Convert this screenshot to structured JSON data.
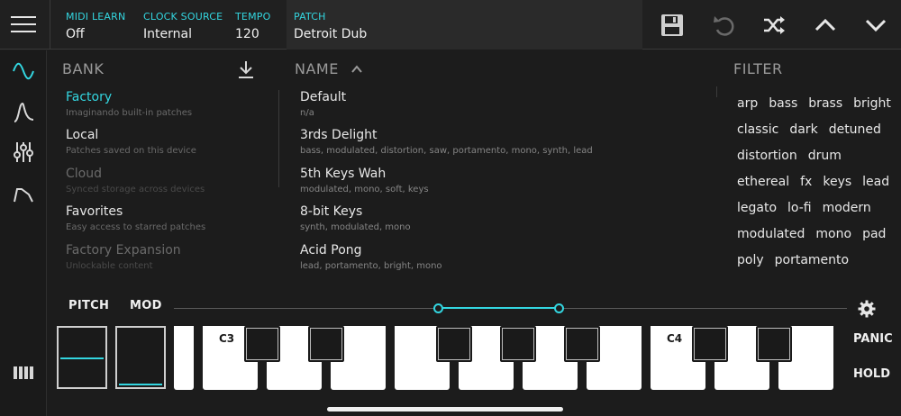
{
  "topbar": {
    "midi_learn": {
      "label": "MIDI LEARN",
      "value": "Off"
    },
    "clock_source": {
      "label": "CLOCK SOURCE",
      "value": "Internal"
    },
    "tempo": {
      "label": "TEMPO",
      "value": "120"
    },
    "patch": {
      "label": "PATCH",
      "value": "Detroit Dub"
    }
  },
  "bank": {
    "header": "BANK",
    "items": [
      {
        "title": "Factory",
        "subtitle": "Imaginando built-in patches"
      },
      {
        "title": "Local",
        "subtitle": "Patches saved on this device"
      },
      {
        "title": "Cloud",
        "subtitle": "Synced storage across devices"
      },
      {
        "title": "Favorites",
        "subtitle": "Easy access to starred patches"
      },
      {
        "title": "Factory Expansion",
        "subtitle": "Unlockable content"
      }
    ]
  },
  "name": {
    "header": "NAME",
    "items": [
      {
        "title": "Default",
        "subtitle": "n/a"
      },
      {
        "title": "3rds Delight",
        "subtitle": "bass, modulated, distortion, saw, portamento, mono, synth, lead"
      },
      {
        "title": "5th Keys Wah",
        "subtitle": "modulated, mono, soft, keys"
      },
      {
        "title": "8-bit Keys",
        "subtitle": "synth, modulated, mono"
      },
      {
        "title": "Acid Pong",
        "subtitle": "lead, portamento, bright, mono"
      }
    ]
  },
  "filter": {
    "header": "FILTER",
    "rows": [
      [
        "arp",
        "bass",
        "brass",
        "bright"
      ],
      [
        "classic",
        "dark",
        "detuned"
      ],
      [
        "distortion",
        "drum"
      ],
      [
        "ethereal",
        "fx",
        "keys",
        "lead"
      ],
      [
        "legato",
        "lo-fi",
        "modern"
      ],
      [
        "modulated",
        "mono",
        "pad"
      ],
      [
        "poly",
        "portamento"
      ]
    ]
  },
  "keyboard": {
    "pitch_label": "PITCH",
    "mod_label": "MOD",
    "c3_label": "C3",
    "c4_label": "C4",
    "panic_label": "PANIC",
    "hold_label": "HOLD"
  },
  "colors": {
    "accent": "#33d6e0",
    "background": "#1c1c1c",
    "topbar": "#202020"
  },
  "icons": [
    "menu-icon",
    "save-icon",
    "undo-icon",
    "shuffle-icon",
    "chevron-up-icon",
    "chevron-down-icon",
    "download-icon",
    "sort-asc-icon",
    "sine-wave-icon",
    "envelope-icon",
    "mixer-icon",
    "filter-shape-icon",
    "keyboard-icon",
    "gear-icon"
  ]
}
